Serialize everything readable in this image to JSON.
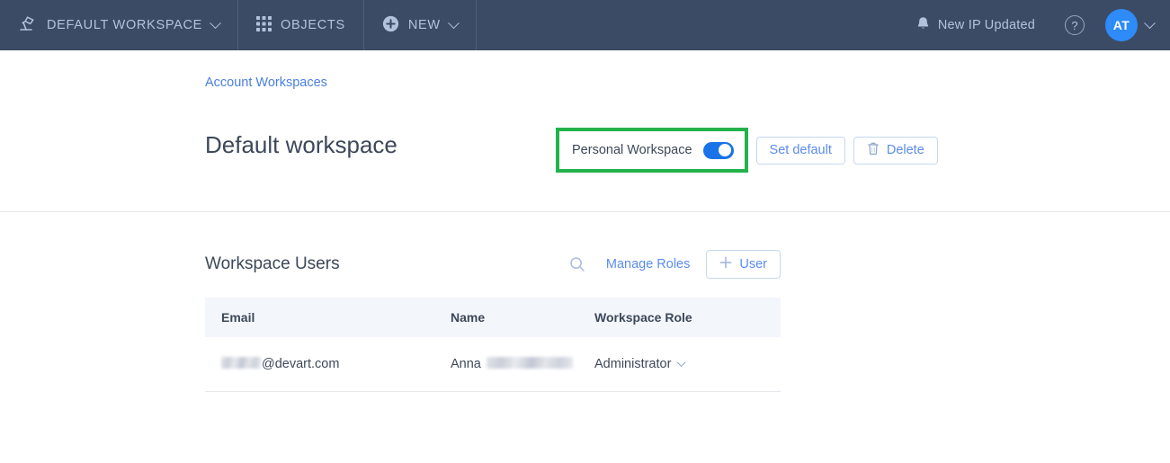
{
  "topbar": {
    "workspace": {
      "label": "DEFAULT WORKSPACE",
      "icon": "desk-lamp-icon"
    },
    "objects": {
      "label": "OBJECTS",
      "icon": "grid-icon"
    },
    "new": {
      "label": "NEW",
      "icon": "plus-circle-icon"
    },
    "notification": {
      "label": "New IP Updated",
      "icon": "bell-icon"
    },
    "help": {
      "label": "?"
    },
    "avatar": {
      "initials": "AT"
    },
    "colors": {
      "background": "#3c4b65",
      "text": "#b3c2dc",
      "avatar": "#2e8bf7"
    }
  },
  "breadcrumb": {
    "label": "Account Workspaces"
  },
  "page": {
    "title": "Default workspace",
    "personal_workspace_label": "Personal Workspace",
    "personal_workspace_on": true,
    "set_default_label": "Set default",
    "delete_label": "Delete",
    "highlight_color": "#22b24c"
  },
  "users": {
    "title": "Workspace Users",
    "search_icon": "search-icon",
    "manage_roles_label": "Manage Roles",
    "add_user_label": "User",
    "columns": [
      "Email",
      "Name",
      "Workspace Role"
    ],
    "rows": [
      {
        "email_suffix": "@devart.com",
        "email_redacted": true,
        "name_prefix": "Anna",
        "name_redacted": true,
        "role": "Administrator"
      }
    ]
  }
}
